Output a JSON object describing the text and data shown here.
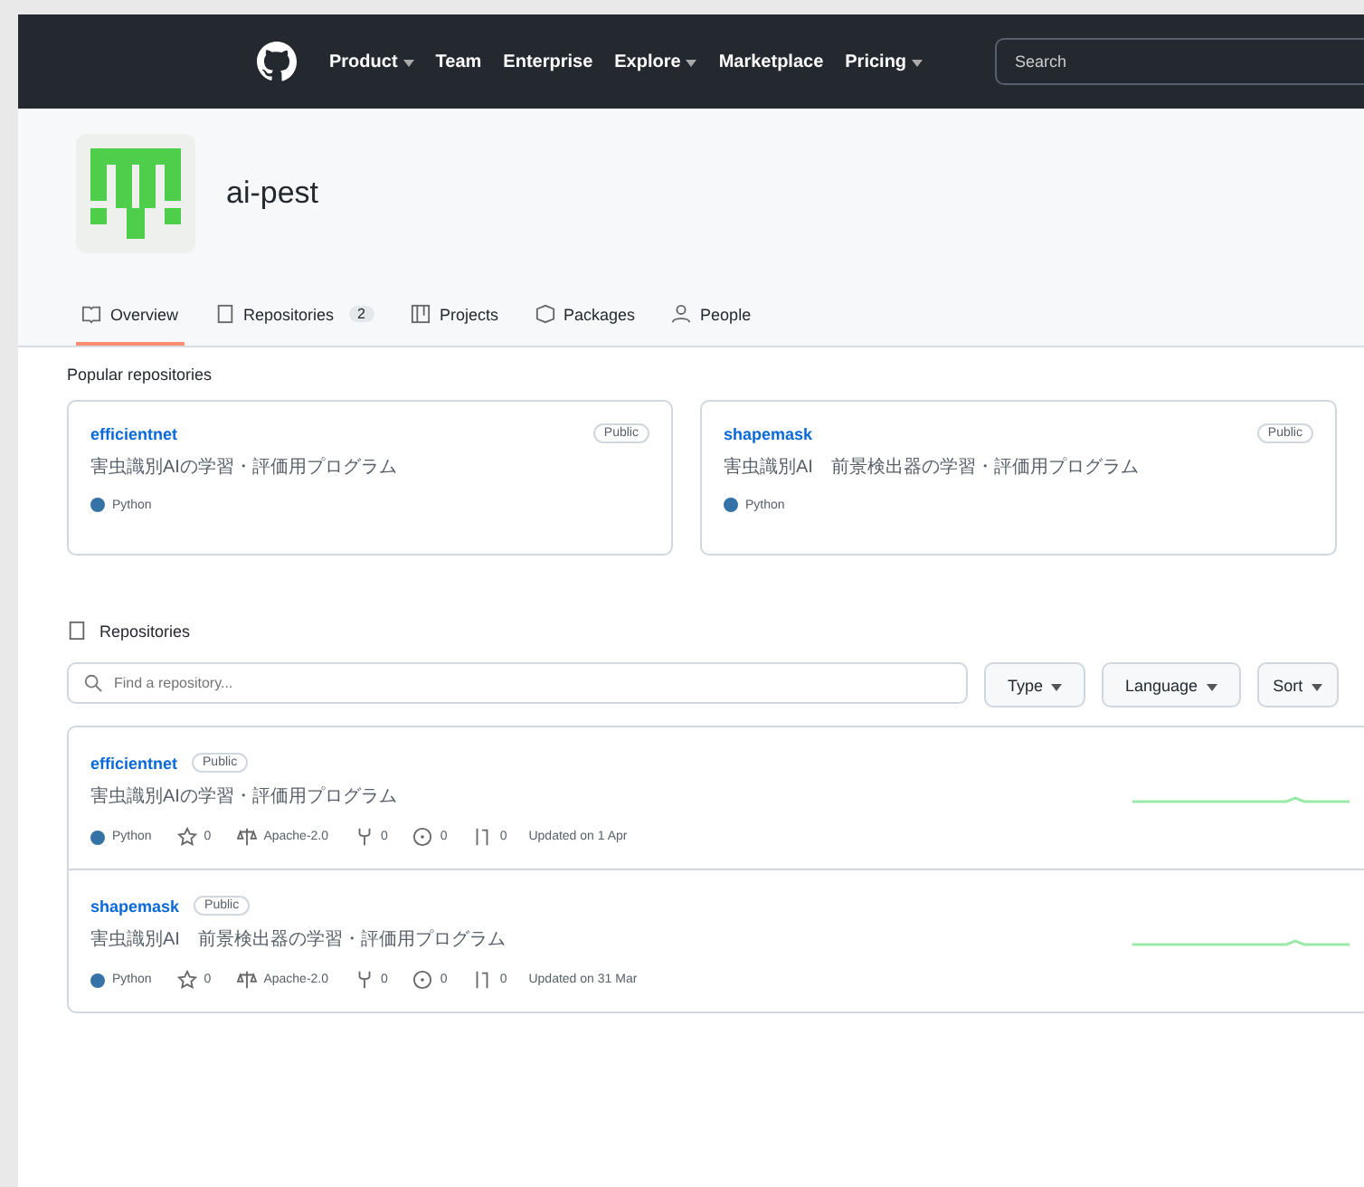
{
  "nav": {
    "items": [
      {
        "label": "Product",
        "dropdown": true
      },
      {
        "label": "Team",
        "dropdown": false
      },
      {
        "label": "Enterprise",
        "dropdown": false
      },
      {
        "label": "Explore",
        "dropdown": true
      },
      {
        "label": "Marketplace",
        "dropdown": false
      },
      {
        "label": "Pricing",
        "dropdown": true
      }
    ],
    "search": {
      "placeholder": "Search"
    }
  },
  "org": {
    "name": "ai-pest"
  },
  "tabs": [
    {
      "label": "Overview",
      "selected": true
    },
    {
      "label": "Repositories",
      "count": "2",
      "selected": false
    },
    {
      "label": "Projects",
      "selected": false
    },
    {
      "label": "Packages",
      "selected": false
    },
    {
      "label": "People",
      "selected": false
    }
  ],
  "popular": {
    "title": "Popular repositories",
    "cards": [
      {
        "name": "efficientnet",
        "visibility": "Public",
        "description": "害虫識別AIの学習・評価用プログラム",
        "language": "Python",
        "color": "#3572a5"
      },
      {
        "name": "shapemask",
        "visibility": "Public",
        "description": "害虫識別AI　前景検出器の学習・評価用プログラム",
        "language": "Python",
        "color": "#3572a5"
      }
    ]
  },
  "repositories": {
    "title": "Repositories",
    "search": {
      "placeholder": "Find a repository..."
    },
    "filters": [
      "Type",
      "Language",
      "Sort"
    ],
    "rows": [
      {
        "name": "efficientnet",
        "visibility": "Public",
        "description": "害虫識別AIの学習・評価用プログラム",
        "language": "Python",
        "color": "#3572a5",
        "stars": "0",
        "license": "Apache-2.0",
        "forks": "0",
        "issues": "0",
        "pulls": "0",
        "updated": "Updated on 1 Apr"
      },
      {
        "name": "shapemask",
        "visibility": "Public",
        "description": "害虫識別AI　前景検出器の学習・評価用プログラム",
        "language": "Python",
        "color": "#3572a5",
        "stars": "0",
        "license": "Apache-2.0",
        "forks": "0",
        "issues": "0",
        "pulls": "0",
        "updated": "Updated on 31 Mar"
      }
    ]
  }
}
